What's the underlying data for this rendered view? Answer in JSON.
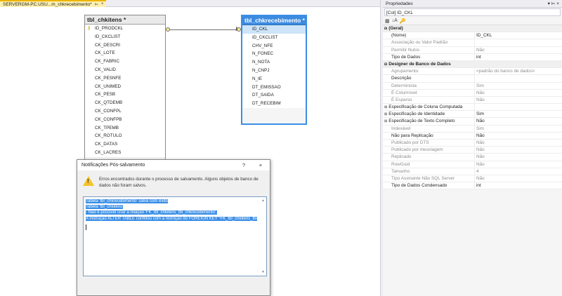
{
  "doc_tab": {
    "label": "SERVERGM-PC.USU...m_chkrecebimento*",
    "pin": "⊨",
    "close": "×"
  },
  "tables": [
    {
      "title": "tbl_chkitens *",
      "columns": [
        "ID_PRODCKL",
        "ID_CKCLIST",
        "CK_DESCRI",
        "CK_LOTE",
        "CK_FABRIC",
        "CK_VALID",
        "CK_PESNFE",
        "CK_UNIMED",
        "CK_PESB",
        "CK_QTDEMB",
        "CK_CONFPL",
        "CK_CONFPB",
        "CK_TPEMB",
        "CK_ROTULO",
        "CK_DATAS",
        "CK_LACRES"
      ]
    },
    {
      "title": "tbl_chkrecebimento *",
      "columns": [
        "ID_CKL",
        "ID_CKCLIST",
        "CHV_NFE",
        "N_FONEC",
        "N_NOTA",
        "N_CNPJ",
        "N_IE",
        "DT_EMISSAO",
        "DT_SAIDA",
        "DT_RECEBIM"
      ]
    }
  ],
  "properties": {
    "header": "Propriedades",
    "pin": "▾ ⊨ ×",
    "object": "[Col] ID_CKL",
    "toolbar": [
      "▦",
      "↓A",
      "🔑"
    ],
    "rows": [
      {
        "type": "cat",
        "name": "(Geral)"
      },
      {
        "name": "(Nome)",
        "value": "ID_CKL"
      },
      {
        "name": "Associação ou Valor Padrão",
        "value": "",
        "dis": true
      },
      {
        "name": "Permitir Nulos",
        "value": "Não",
        "dis": true
      },
      {
        "name": "Tipo de Dados",
        "value": "int"
      },
      {
        "type": "cat",
        "name": "Designer de Banco de Dados"
      },
      {
        "name": "Agrupamento",
        "value": "<padrão do banco de dados>",
        "dis": true
      },
      {
        "name": "Descrição",
        "value": ""
      },
      {
        "name": "Determinista",
        "value": "Sim",
        "dis": true
      },
      {
        "name": "É Columnset",
        "value": "Não",
        "dis": true
      },
      {
        "name": "É Esparso",
        "value": "Não",
        "dis": true
      },
      {
        "type": "exp",
        "name": "Especificação de Coluna Computada",
        "value": ""
      },
      {
        "type": "exp",
        "name": "Especificação de Identidade",
        "value": "Sim"
      },
      {
        "type": "exp",
        "name": "Especificação de Texto Completo",
        "value": "Não"
      },
      {
        "name": "Indexável",
        "value": "Sim",
        "dis": true
      },
      {
        "name": "Não para Replicação",
        "value": "Não"
      },
      {
        "name": "Publicado por DTS",
        "value": "Não",
        "dis": true
      },
      {
        "name": "Publicado por mesclagem",
        "value": "Não",
        "dis": true
      },
      {
        "name": "Replicado",
        "value": "Não",
        "dis": true
      },
      {
        "name": "RowGuid",
        "value": "Não",
        "dis": true
      },
      {
        "name": "Tamanho",
        "value": "4",
        "dis": true
      },
      {
        "name": "Tipo Assinante Não SQL Server",
        "value": "Não",
        "dis": true
      },
      {
        "name": "Tipo de Dados Condensado",
        "value": "int"
      }
    ]
  },
  "dialog": {
    "title": "Notificações Pós-salvamento",
    "help": "?",
    "close": "×",
    "message": "Erros encontrados durante o processo de salvamento. Alguns objetos de banco de dados não foram salvos.",
    "output": [
      "Tabela 'tbl_chkrecebimento' salva com êxito",
      "Tabela 'tbl_chkitens'",
      "- Não é possível criar a relação 'FK_tbl_chkitens_tbl_chkrecebimento'.",
      "A instrução ALTER TABLE conflitou com a restrição do FOREIGN KEY \"FK_tbl_chkitens_tbl"
    ],
    "scroll_up": "▲",
    "scroll_down": "▼"
  }
}
